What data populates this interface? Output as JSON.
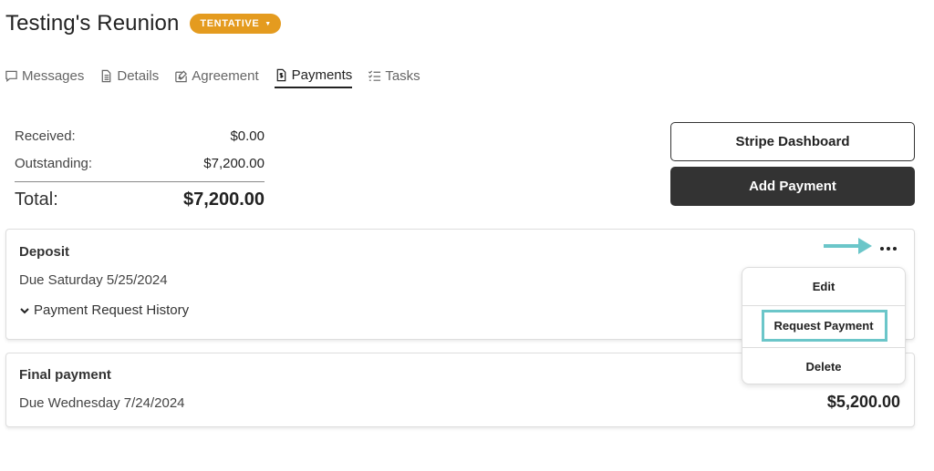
{
  "event": {
    "title": "Testing's Reunion",
    "status": "TENTATIVE"
  },
  "tabs": [
    {
      "label": "Messages"
    },
    {
      "label": "Details"
    },
    {
      "label": "Agreement"
    },
    {
      "label": "Payments"
    },
    {
      "label": "Tasks"
    }
  ],
  "active_tab": "Payments",
  "summary": {
    "received_label": "Received:",
    "received_value": "$0.00",
    "outstanding_label": "Outstanding:",
    "outstanding_value": "$7,200.00",
    "total_label": "Total:",
    "total_value": "$7,200.00"
  },
  "actions": {
    "stripe_label": "Stripe Dashboard",
    "add_payment_label": "Add Payment"
  },
  "payments": [
    {
      "title": "Deposit",
      "due": "Due Saturday 5/25/2024",
      "history_label": "Payment Request History"
    },
    {
      "title": "Final payment",
      "due": "Due Wednesday 7/24/2024",
      "amount": "$5,200.00"
    }
  ],
  "menu": {
    "edit": "Edit",
    "request_payment": "Request Payment",
    "delete": "Delete"
  },
  "colors": {
    "status_badge": "#e49b1f",
    "dark_button": "#333333",
    "highlight": "#6bc6c9"
  },
  "icons": {
    "messages": "message-icon",
    "details": "document-icon",
    "agreement": "signature-icon",
    "payments": "invoice-dollar-icon",
    "tasks": "checklist-icon",
    "more": "more-dots-icon",
    "history_toggle": "chevron-down-icon"
  }
}
